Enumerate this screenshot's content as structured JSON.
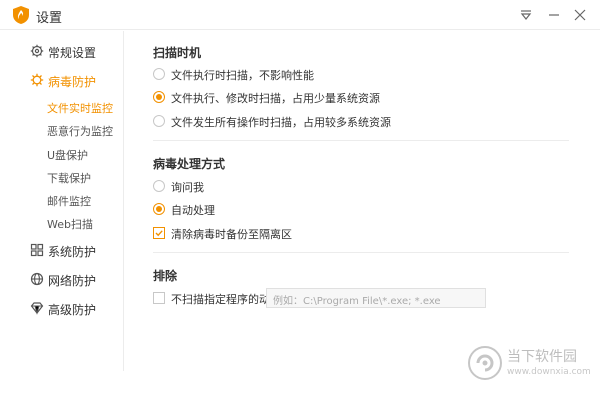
{
  "window": {
    "title": "设置",
    "accent": "#f29100"
  },
  "titlebar_buttons": [
    "dropdown-icon",
    "minimize-icon",
    "close-icon"
  ],
  "sidebar": {
    "items": [
      {
        "label": "常规设置",
        "icon": "gear-icon"
      },
      {
        "label": "病毒防护",
        "icon": "virus-icon",
        "active": true
      },
      {
        "label": "系统防护",
        "icon": "windows-icon"
      },
      {
        "label": "网络防护",
        "icon": "globe-icon"
      },
      {
        "label": "高级防护",
        "icon": "diamond-icon"
      }
    ],
    "sub_items": [
      {
        "label": "文件实时监控",
        "active": true
      },
      {
        "label": "恶意行为监控"
      },
      {
        "label": "U盘保护"
      },
      {
        "label": "下载保护"
      },
      {
        "label": "邮件监控"
      },
      {
        "label": "Web扫描"
      }
    ]
  },
  "scan_timing": {
    "title": "扫描时机",
    "options": [
      {
        "label": "文件执行时扫描，不影响性能",
        "checked": false
      },
      {
        "label": "文件执行、修改时扫描，占用少量系统资源",
        "checked": true
      },
      {
        "label": "文件发生所有操作时扫描，占用较多系统资源",
        "checked": false
      }
    ]
  },
  "virus_handling": {
    "title": "病毒处理方式",
    "options": [
      {
        "label": "询问我",
        "checked": false
      },
      {
        "label": "自动处理",
        "checked": true
      }
    ],
    "backup_checkbox": {
      "label": "清除病毒时备份至隔离区",
      "checked": true
    }
  },
  "exclusion": {
    "title": "排除",
    "checkbox": {
      "label": "不扫描指定程序的动作",
      "checked": false
    },
    "input_placeholder": "例如：C:\\Program File\\*.exe; *.exe"
  },
  "watermark": {
    "title": "当下软件园",
    "url": "www.downxia.com"
  }
}
